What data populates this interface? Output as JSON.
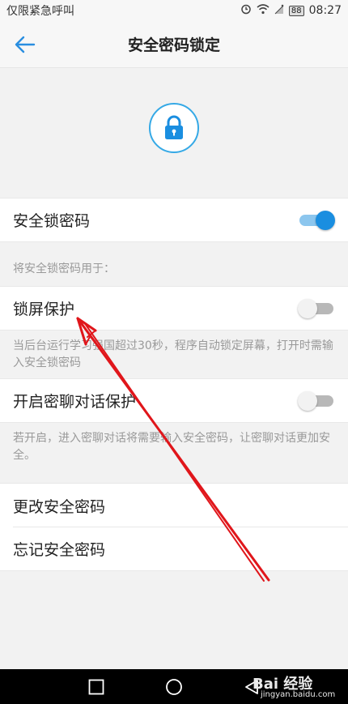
{
  "status_bar": {
    "carrier": "仅限紧急呼叫",
    "battery": "88",
    "time": "08:27"
  },
  "header": {
    "title": "安全密码锁定"
  },
  "security_lock_row": {
    "label": "安全锁密码",
    "enabled": true
  },
  "section_caption": "将安全锁密码用于：",
  "lock_screen_row": {
    "label": "锁屏保护",
    "enabled": false,
    "hint": "当后台运行学习强国超过30秒，程序自动锁定屏幕，打开时需输入安全锁密码"
  },
  "secret_chat_row": {
    "label": "开启密聊对话保护",
    "enabled": false,
    "hint": "若开启，进入密聊对话将需要输入安全密码，让密聊对话更加安全。"
  },
  "change_password_row": {
    "label": "更改安全密码"
  },
  "forgot_password_row": {
    "label": "忘记安全密码"
  },
  "watermark": {
    "logo_text": "Bai 经验",
    "url": "jingyan.baidu.com"
  },
  "colors": {
    "accent": "#1a8ee0",
    "lock_ring": "#35a9e6",
    "annotation_arrow": "#e0161b"
  },
  "icons": [
    "back-arrow-icon",
    "lock-icon",
    "square-icon",
    "circle-icon",
    "triangle-back-icon",
    "alarm-icon",
    "wifi-icon",
    "signal-icon"
  ]
}
